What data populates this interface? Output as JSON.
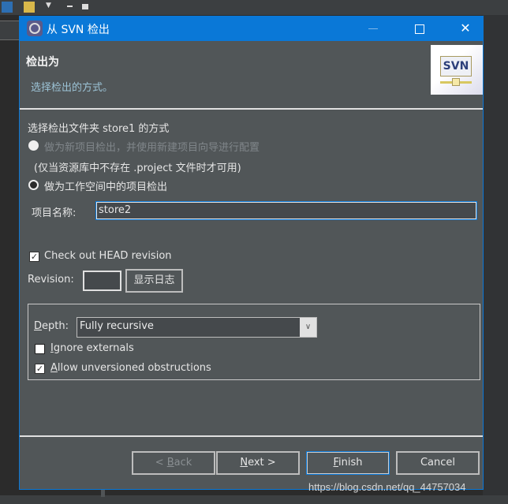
{
  "window": {
    "title": "从 SVN 检出",
    "controls": {
      "minimize": "—",
      "maximize": "□",
      "close": "✕"
    }
  },
  "header": {
    "title": "检出为",
    "description": "选择检出的方式。",
    "logo_text": "SVN"
  },
  "checkout_method": {
    "heading": "选择检出文件夹 store1 的方式",
    "option_new_project": {
      "label": "做为新项目检出，并使用新建项目向导进行配置",
      "enabled": false,
      "selected": false
    },
    "option_new_project_note": "(仅当资源库中不存在 .project 文件时才可用)",
    "option_workspace": {
      "label": "做为工作空间中的项目检出",
      "enabled": true,
      "selected": true
    },
    "project_name_label": "项目名称:",
    "project_name_value": "store2"
  },
  "revision": {
    "head_checkbox_label": "Check out HEAD revision",
    "head_checked": true,
    "revision_label": "Revision:",
    "revision_value": "",
    "show_log_button": "显示日志"
  },
  "options": {
    "depth_label_mnemonic": "D",
    "depth_label_rest": "epth:",
    "depth_value": "Fully recursive",
    "ignore_externals_mnemonic": "I",
    "ignore_externals_rest": "gnore externals",
    "ignore_externals_checked": false,
    "allow_unversioned_mnemonic": "A",
    "allow_unversioned_rest": "llow unversioned obstructions",
    "allow_unversioned_checked": true
  },
  "buttons": {
    "back_prefix": "< ",
    "back_mnemonic": "B",
    "back_rest": "ack",
    "back_enabled": false,
    "next_mnemonic": "N",
    "next_rest": "ext >",
    "finish_mnemonic": "F",
    "finish_rest": "inish",
    "cancel": "Cancel"
  },
  "watermark": "https://blog.csdn.net/qq_44757034",
  "colors": {
    "accent": "#0a78d7",
    "dialog_bg": "#515658",
    "description": "#9cc3d6"
  }
}
